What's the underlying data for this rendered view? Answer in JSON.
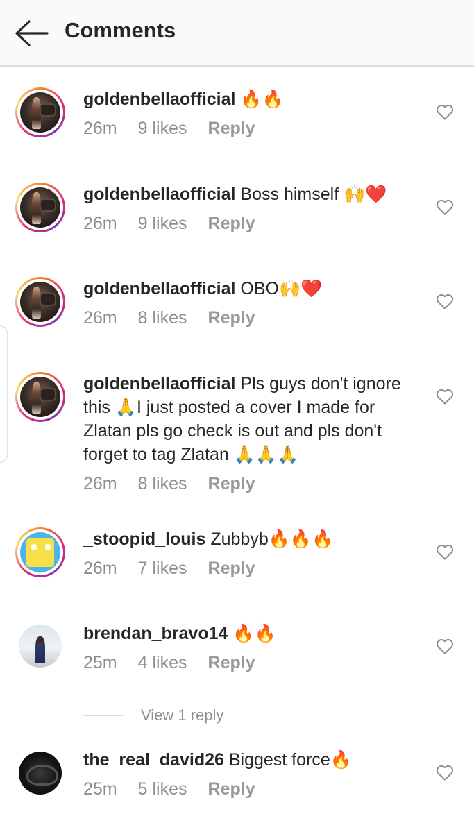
{
  "header": {
    "title": "Comments",
    "back_icon": "arrow-left-icon"
  },
  "view_replies": "View 1 reply",
  "comments": [
    {
      "user": "goldenbellaofficial",
      "text": " 🔥🔥",
      "time": "26m",
      "likes": "9 likes",
      "reply": "Reply"
    },
    {
      "user": "goldenbellaofficial",
      "text": " Boss himself 🙌❤️",
      "time": "26m",
      "likes": "9 likes",
      "reply": "Reply"
    },
    {
      "user": "goldenbellaofficial",
      "text": " OBO🙌❤️",
      "time": "26m",
      "likes": "8 likes",
      "reply": "Reply"
    },
    {
      "user": "goldenbellaofficial",
      "text": " Pls guys don't ignore this 🙏I just posted a cover I made for Zlatan pls go check is out and pls don't forget to tag Zlatan 🙏🙏🙏",
      "time": "26m",
      "likes": "8 likes",
      "reply": "Reply"
    },
    {
      "user": "_stoopid_louis",
      "text": " Zubbyb🔥🔥🔥",
      "time": "26m",
      "likes": "7 likes",
      "reply": "Reply"
    },
    {
      "user": "brendan_bravo14",
      "text": " 🔥🔥",
      "time": "25m",
      "likes": "4 likes",
      "reply": "Reply"
    },
    {
      "user": "the_real_david26",
      "text": " Biggest force🔥",
      "time": "25m",
      "likes": "5 likes",
      "reply": "Reply"
    }
  ]
}
